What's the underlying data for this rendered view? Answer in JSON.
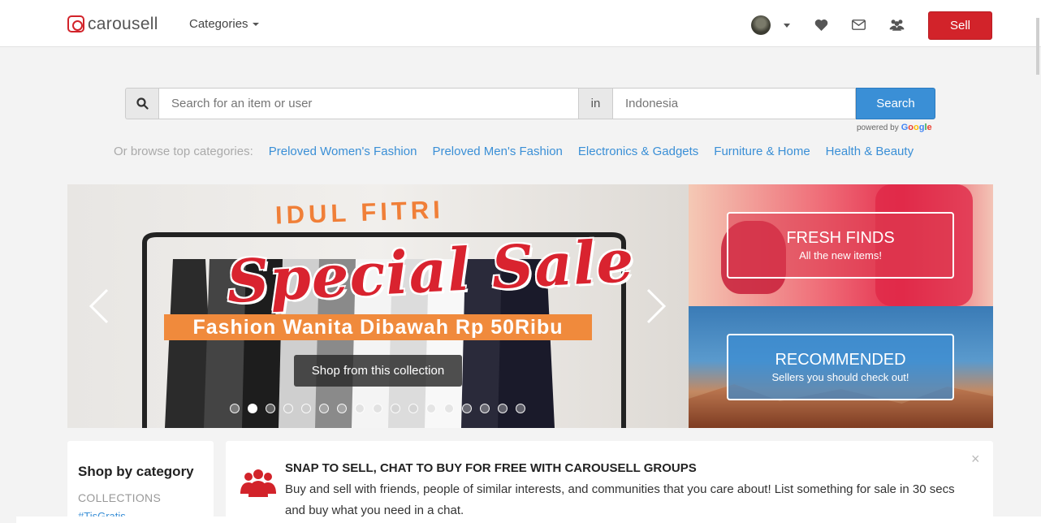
{
  "header": {
    "logo_text": "carousell",
    "categories_label": "Categories",
    "sell_label": "Sell"
  },
  "search": {
    "placeholder": "Search for an item or user",
    "in_label": "in",
    "location_placeholder": "Indonesia",
    "button_label": "Search",
    "powered_by": "powered by",
    "google": [
      "G",
      "o",
      "o",
      "g",
      "l",
      "e"
    ]
  },
  "browse": {
    "label": "Or browse top categories:",
    "links": [
      "Preloved Women's Fashion",
      "Preloved Men's Fashion",
      "Electronics & Gadgets",
      "Furniture & Home",
      "Health & Beauty"
    ]
  },
  "carousel": {
    "headline_top": "IDUL FITRI",
    "headline_main": "Special Sale",
    "headline_band": "Fashion Wanita Dibawah Rp 50Ribu",
    "cta_label": "Shop from this collection",
    "slide_count": 17,
    "active_slide": 2
  },
  "tiles": {
    "fresh": {
      "title": "FRESH FINDS",
      "subtitle": "All the new items!"
    },
    "recommended": {
      "title": "RECOMMENDED",
      "subtitle": "Sellers you should check out!"
    }
  },
  "category_panel": {
    "title": "Shop by category",
    "section": "COLLECTIONS",
    "first_item": "#TisGratis"
  },
  "promo": {
    "title": "SNAP TO SELL, CHAT TO BUY FOR FREE WITH CAROUSELL GROUPS",
    "text": "Buy and sell with friends, people of similar interests, and communities that you care about! List something for sale in 30 secs and buy what you need in a chat.",
    "close": "×"
  },
  "colors": {
    "brand": "#d2232a",
    "link": "#3a8fd6",
    "search_button": "#3a8fd6"
  }
}
